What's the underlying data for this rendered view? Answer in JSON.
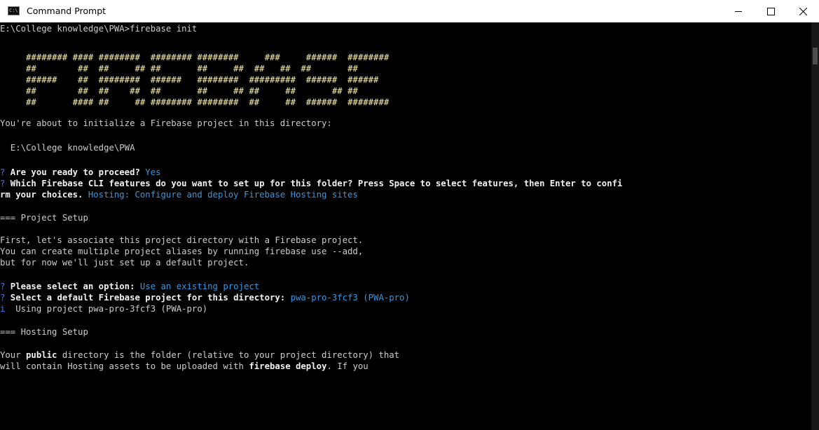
{
  "window": {
    "title": "Command Prompt",
    "icon_text": "C:\\",
    "minimize_icon": "minimize-icon",
    "maximize_icon": "maximize-icon",
    "close_icon": "close-icon"
  },
  "colors": {
    "background": "#000000",
    "text": "#cccccc",
    "question_mark": "#3b78ff",
    "banner": "#f9f1a5",
    "answer": "#3a96dd"
  },
  "console": {
    "prompt_line": "E:\\College knowledge\\PWA>firebase init",
    "banner": [
      "     ######## #### ########  ######## ########     ###     ######  ########",
      "     ##        ##  ##     ## ##       ##     ##  ##   ##  ##       ##",
      "     ######    ##  ########  ######   ########  #########  ######  ######",
      "     ##        ##  ##    ##  ##       ##     ## ##     ##       ## ##",
      "     ##       #### ##     ## ######## ########  ##     ##  ######  ########"
    ],
    "intro": "You're about to initialize a Firebase project in this directory:",
    "directory": "  E:\\College knowledge\\PWA",
    "q_mark": "?",
    "q1": " Are you ready to proceed?",
    "a1": " Yes",
    "q2_line1": " Which Firebase CLI features do you want to set up for this folder? Press Space to select features, then Enter to confi",
    "q2_line2": "rm your choices.",
    "a2": " Hosting: Configure and deploy Firebase Hosting sites",
    "project_setup": "=== Project Setup",
    "assoc_1": "First, let's associate this project directory with a Firebase project.",
    "assoc_2": "You can create multiple project aliases by running firebase use --add,",
    "assoc_3": "but for now we'll just set up a default project.",
    "q3": " Please select an option:",
    "a3": " Use an existing project",
    "q4": " Select a default Firebase project for this directory:",
    "a4": " pwa-pro-3fcf3 (PWA-pro)",
    "info_mark": "i",
    "info_text": "  Using project pwa-pro-3fcf3 (PWA-pro)",
    "hosting_setup": "=== Hosting Setup",
    "public_1a": "Your ",
    "public_1b": "public",
    "public_1c": " directory is the folder (relative to your project directory) that",
    "public_2a": "will contain Hosting assets to be uploaded with ",
    "public_2b": "firebase deploy",
    "public_2c": ". If you"
  }
}
